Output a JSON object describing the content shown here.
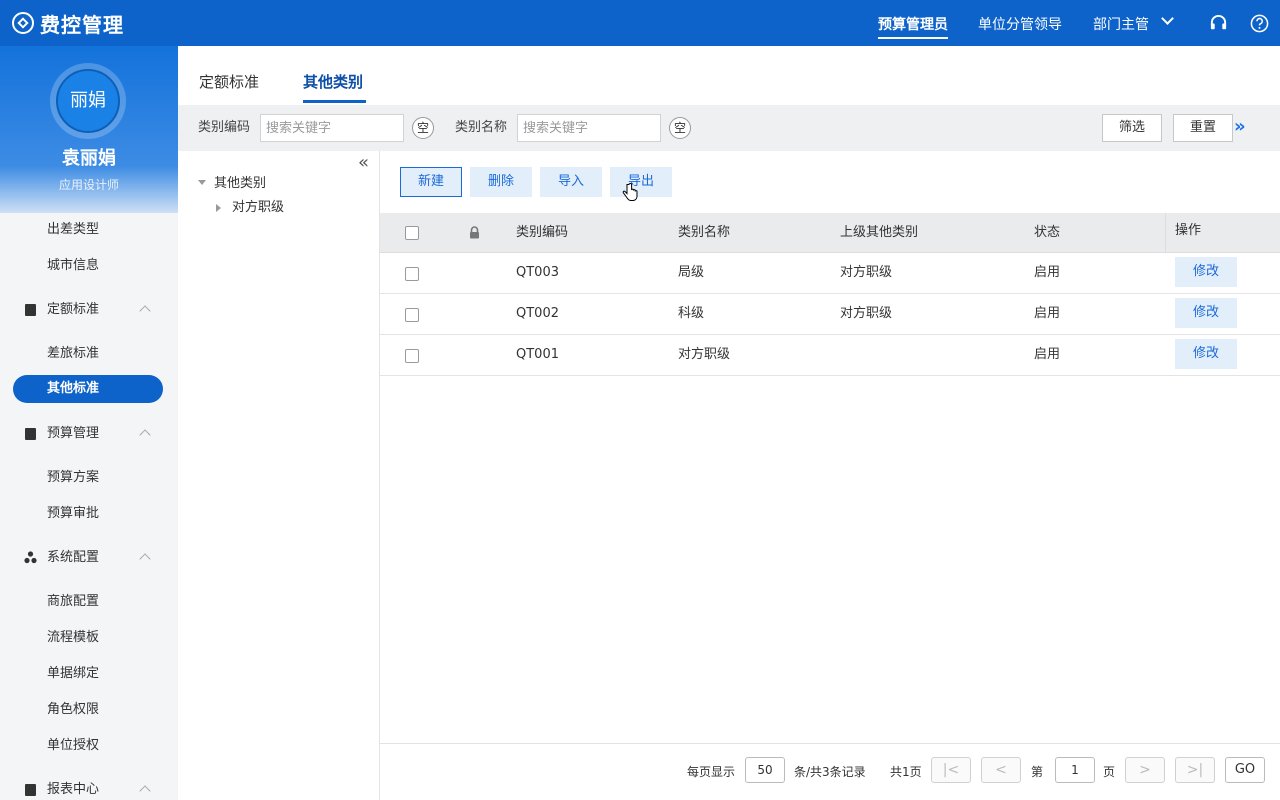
{
  "app": {
    "title": "费控管理"
  },
  "header": {
    "roles": [
      "预算管理员",
      "单位分管领导",
      "部门主管"
    ],
    "active_role": "预算管理员",
    "icons": [
      "headset-icon",
      "help-icon"
    ]
  },
  "profile": {
    "avatar_text": "丽娟",
    "name": "袁丽娟",
    "title": "应用设计师"
  },
  "sidebar": {
    "items": [
      {
        "label": "出差类型",
        "type": "item"
      },
      {
        "label": "城市信息",
        "type": "item"
      },
      {
        "label": "定额标准",
        "type": "group",
        "icon": "document-icon"
      },
      {
        "label": "差旅标准",
        "type": "item"
      },
      {
        "label": "其他标准",
        "type": "item",
        "active": true
      },
      {
        "label": "预算管理",
        "type": "group",
        "icon": "calculator-icon"
      },
      {
        "label": "预算方案",
        "type": "item"
      },
      {
        "label": "预算审批",
        "type": "item"
      },
      {
        "label": "系统配置",
        "type": "group",
        "icon": "cluster-icon"
      },
      {
        "label": "商旅配置",
        "type": "item"
      },
      {
        "label": "流程模板",
        "type": "item"
      },
      {
        "label": "单据绑定",
        "type": "item"
      },
      {
        "label": "角色权限",
        "type": "item"
      },
      {
        "label": "单位授权",
        "type": "item"
      },
      {
        "label": "报表中心",
        "type": "group",
        "icon": "report-icon"
      }
    ]
  },
  "tabs": [
    {
      "label": "定额标准",
      "active": false
    },
    {
      "label": "其他类别",
      "active": true
    }
  ],
  "filter": {
    "code_label": "类别编码",
    "code_placeholder": "搜索关键字",
    "name_label": "类别名称",
    "name_placeholder": "搜索关键字",
    "clear_label": "空",
    "filter_button": "筛选",
    "reset_button": "重置",
    "expand_glyph": "»"
  },
  "tree": {
    "collapse_glyph": "«",
    "root": "其他类别",
    "children": [
      "对方职级"
    ]
  },
  "actions": {
    "new": "新建",
    "delete": "删除",
    "import": "导入",
    "export": "导出"
  },
  "table": {
    "columns": [
      "类别编码",
      "类别名称",
      "上级其他类别",
      "状态",
      "操作"
    ],
    "rows": [
      {
        "code": "QT003",
        "name": "局级",
        "parent": "对方职级",
        "status": "启用",
        "action": "修改"
      },
      {
        "code": "QT002",
        "name": "科级",
        "parent": "对方职级",
        "status": "启用",
        "action": "修改"
      },
      {
        "code": "QT001",
        "name": "对方职级",
        "parent": "",
        "status": "启用",
        "action": "修改"
      }
    ]
  },
  "pager": {
    "per_page_label": "每页显示",
    "per_page": "50",
    "records_text": "条/共3条记录",
    "total_pages_text": "共1页",
    "page_prefix": "第",
    "current_page": "1",
    "page_suffix": "页",
    "go_label": "GO",
    "first_glyph": "|<",
    "prev_glyph": "<",
    "next_glyph": ">",
    "last_glyph": ">|"
  },
  "colors": {
    "primary": "#0d63c9",
    "link": "#1a6ad8",
    "button_bg": "#e3eefb"
  }
}
